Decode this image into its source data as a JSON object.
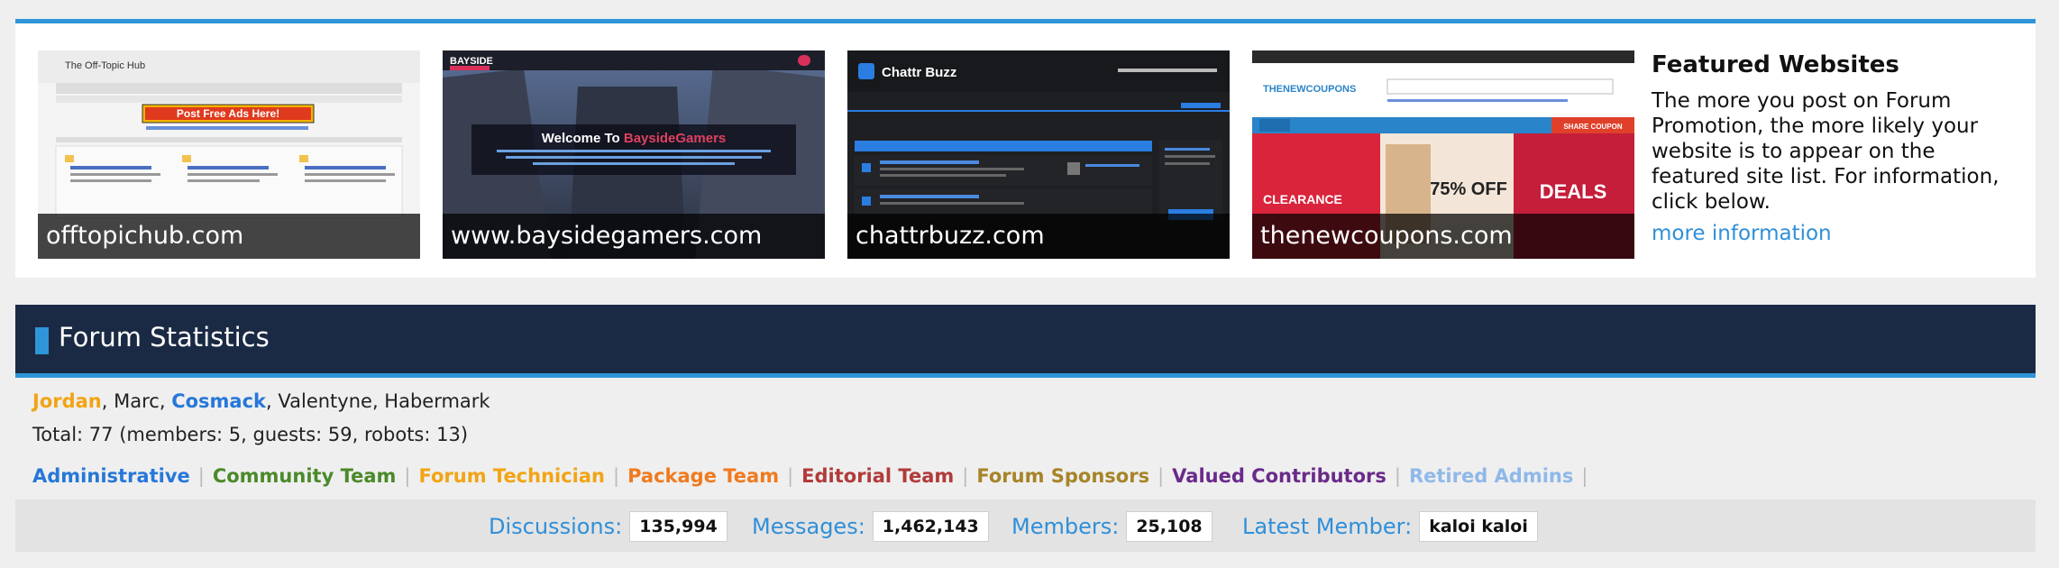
{
  "featured": {
    "title": "Featured Websites",
    "description": "The more you post on Forum Promotion, the more likely your website is to appear on the featured site list. For information, click below.",
    "more_link": "more information",
    "sites": [
      {
        "caption": "offtopichub.com",
        "screenshot": {
          "site_name": "The Off-Topic Hub",
          "banner": "Post Free Ads Here!"
        }
      },
      {
        "caption": "www.baysidegamers.com",
        "screenshot": {
          "logo": "BAYSIDE",
          "welcome_prefix": "Welcome To ",
          "welcome_name": "BaysideGamers"
        }
      },
      {
        "caption": "chattrbuzz.com",
        "screenshot": {
          "logo": "Chattr Buzz"
        }
      },
      {
        "caption": "thenewcoupons.com",
        "screenshot": {
          "logo": "THENEWCOUPONS",
          "promo_1": "75% OFF",
          "promo_2": "DEALS",
          "promo_3": "CLEARANCE",
          "share": "SHARE COUPON"
        }
      }
    ]
  },
  "stats": {
    "title": "Forum Statistics",
    "online_users": [
      "Jordan",
      "Marc",
      "Cosmack",
      "Valentyne",
      "Habermark"
    ],
    "total": "Total: 77 (members: 5, guests: 59, robots: 13)",
    "groups": [
      {
        "label": "Administrative",
        "color": "#2677d9"
      },
      {
        "label": "Community Team",
        "color": "#4a8a2a"
      },
      {
        "label": "Forum Technician",
        "color": "#f2a414"
      },
      {
        "label": "Package Team",
        "color": "#f07a1e"
      },
      {
        "label": "Editorial Team",
        "color": "#b23a3a"
      },
      {
        "label": "Forum Sponsors",
        "color": "#a68428"
      },
      {
        "label": "Valued Contributors",
        "color": "#6a2a8a"
      },
      {
        "label": "Retired Admins",
        "color": "#8fb8ea"
      }
    ],
    "counters": {
      "discussions_label": "Discussions:",
      "discussions_value": "135,994",
      "messages_label": "Messages:",
      "messages_value": "1,462,143",
      "members_label": "Members:",
      "members_value": "25,108",
      "latest_label": "Latest Member:",
      "latest_value": "kaloi kaloi"
    }
  }
}
